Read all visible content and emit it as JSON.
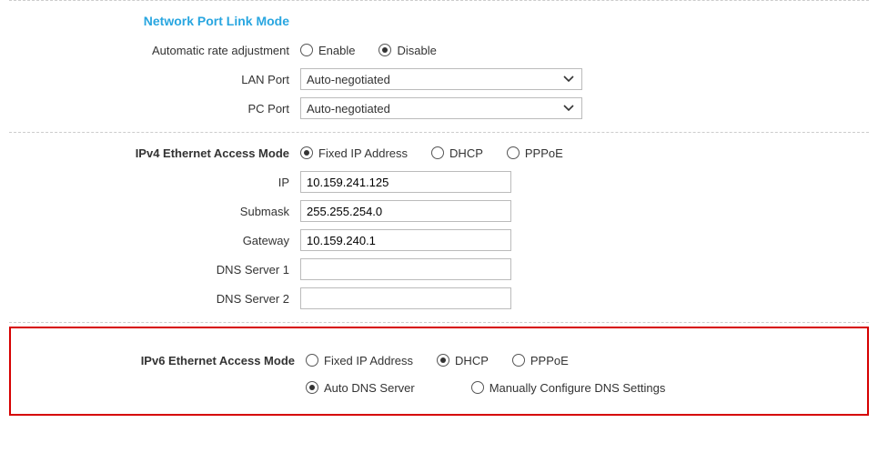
{
  "linkMode": {
    "title": "Network Port Link Mode",
    "autoRate": {
      "label": "Automatic rate adjustment",
      "enable": "Enable",
      "disable": "Disable",
      "selected": "Disable"
    },
    "lanPort": {
      "label": "LAN Port",
      "value": "Auto-negotiated"
    },
    "pcPort": {
      "label": "PC Port",
      "value": "Auto-negotiated"
    }
  },
  "ipv4": {
    "title": "IPv4 Ethernet Access Mode",
    "modes": {
      "fixed": "Fixed IP Address",
      "dhcp": "DHCP",
      "pppoe": "PPPoE",
      "selected": "Fixed IP Address"
    },
    "ip": {
      "label": "IP",
      "value": "10.159.241.125"
    },
    "submask": {
      "label": "Submask",
      "value": "255.255.254.0"
    },
    "gateway": {
      "label": "Gateway",
      "value": "10.159.240.1"
    },
    "dns1": {
      "label": "DNS Server 1",
      "value": ""
    },
    "dns2": {
      "label": "DNS Server 2",
      "value": ""
    }
  },
  "ipv6": {
    "title": "IPv6 Ethernet Access Mode",
    "modes": {
      "fixed": "Fixed IP Address",
      "dhcp": "DHCP",
      "pppoe": "PPPoE",
      "selected": "DHCP"
    },
    "dns": {
      "auto": "Auto DNS Server",
      "manual": "Manually Configure DNS Settings",
      "selected": "Auto DNS Server"
    }
  }
}
